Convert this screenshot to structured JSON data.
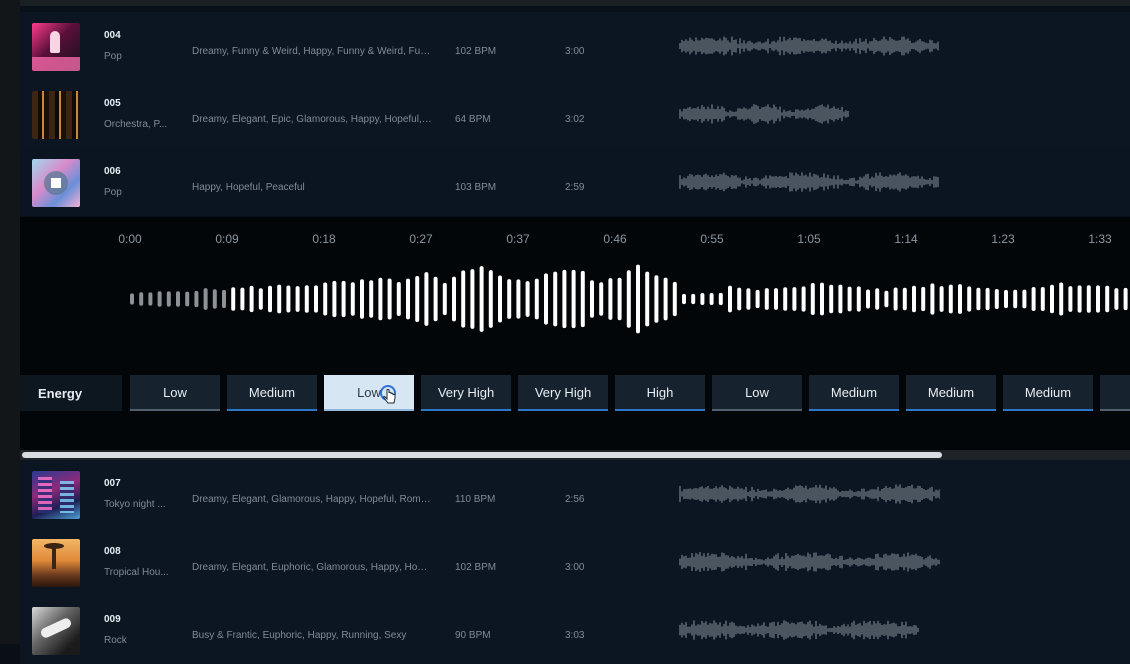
{
  "tracks_top": [
    {
      "number": "004",
      "genre": "Pop",
      "tags": "Dreamy, Funny & Weird, Happy, Funny & Weird, Fun...",
      "bpm": "102 BPM",
      "duration": "3:00"
    },
    {
      "number": "005",
      "genre": "Orchestra, P...",
      "tags": "Dreamy, Elegant, Epic, Glamorous, Happy, Hopeful, ...",
      "bpm": "64 BPM",
      "duration": "3:02"
    },
    {
      "number": "006",
      "genre": "Pop",
      "tags": "Happy, Hopeful, Peaceful",
      "bpm": "103 BPM",
      "duration": "2:59"
    }
  ],
  "player": {
    "timeline": [
      "0:00",
      "0:09",
      "0:18",
      "0:27",
      "0:37",
      "0:46",
      "0:55",
      "1:05",
      "1:14",
      "1:23",
      "1:33"
    ]
  },
  "energy": {
    "label": "Energy",
    "segments": [
      "Low",
      "Medium",
      "Low",
      "Very High",
      "Very High",
      "High",
      "Low",
      "Medium",
      "Medium",
      "Medium"
    ],
    "selected_index": 2
  },
  "scroll_position": 0.83,
  "tracks_bottom": [
    {
      "number": "007",
      "genre": "Tokyo night ...",
      "tags": "Dreamy, Elegant, Glamorous, Happy, Hopeful, Roma...",
      "bpm": "110 BPM",
      "duration": "2:56"
    },
    {
      "number": "008",
      "genre": "Tropical Hou...",
      "tags": "Dreamy, Elegant, Euphoric, Glamorous, Happy, Hope...",
      "bpm": "102 BPM",
      "duration": "3:00"
    },
    {
      "number": "009",
      "genre": "Rock",
      "tags": "Busy & Frantic, Euphoric, Happy, Running, Sexy",
      "bpm": "90 BPM",
      "duration": "3:03"
    }
  ]
}
